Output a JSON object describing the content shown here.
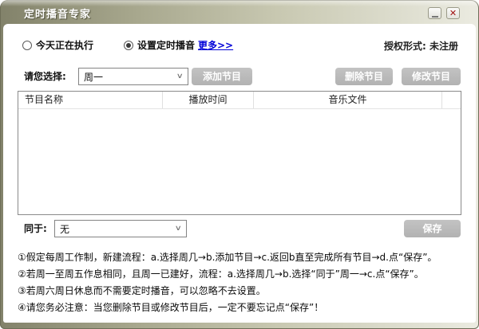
{
  "window": {
    "title": "定时播音专家",
    "close_glyph": "✕"
  },
  "top_row": {
    "radio_today_label": "今天正在执行",
    "radio_schedule_label": "设置定时播音",
    "more_link": "更多>>",
    "license_text": "授权形式: 未注册"
  },
  "controls": {
    "select_prompt_label": "请您选择:",
    "week_select_value": "周一",
    "add_button": "添加节目",
    "delete_button": "删除节目",
    "modify_button": "修改节目"
  },
  "table": {
    "headers": [
      "节目名称",
      "播放时间",
      "音乐文件"
    ]
  },
  "bottom_row": {
    "same_as_label": "同于:",
    "same_as_select_value": "无",
    "save_button": "保存"
  },
  "instructions": [
    "①假定每周工作制，新建流程：a.选择周几→b.添加节目→c.返回b直至完成所有节目→d.点“保存”。",
    "②若周一至周五作息相同，且周一已建好，流程：a.选择周几→b.选择“同于”周一→c.点“保存”。",
    "③若周六周日休息而不需要定时播音，可以忽略不去设置。",
    "④请您务必注意：当您删除节目或修改节目后，一定不要忘记点“保存”！"
  ]
}
